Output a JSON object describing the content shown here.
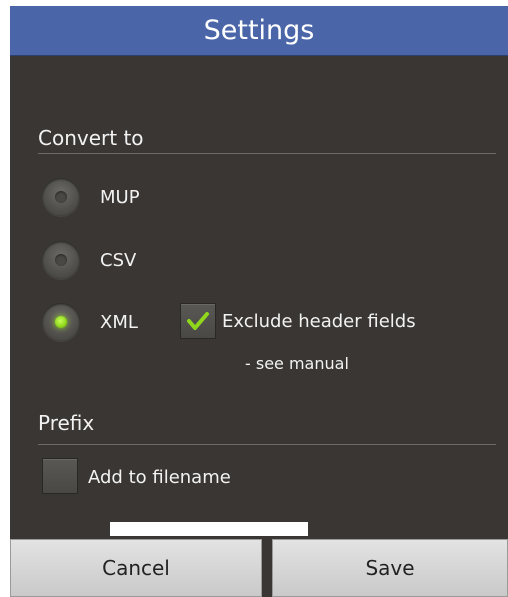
{
  "dialog": {
    "title": "Settings"
  },
  "convert": {
    "section_title": "Convert to",
    "options": [
      {
        "label": "MUP",
        "checked": false
      },
      {
        "label": "CSV",
        "checked": false
      },
      {
        "label": "XML",
        "checked": true
      }
    ],
    "exclude_header": {
      "label": "Exclude header fields",
      "checked": true,
      "note": "- see manual"
    }
  },
  "prefix": {
    "section_title": "Prefix",
    "add_to_filename": {
      "label": "Add to filename",
      "checked": false
    },
    "value": ""
  },
  "buttons": {
    "cancel": "Cancel",
    "save": "Save"
  },
  "colors": {
    "titlebar": "#4a66a9",
    "background": "#393633",
    "accent_check": "#8fd61c"
  }
}
